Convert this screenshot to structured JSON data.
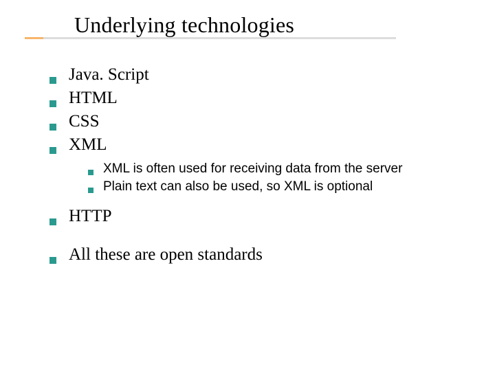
{
  "title": "Underlying technologies",
  "bullets": {
    "items": [
      {
        "label": "Java. Script"
      },
      {
        "label": "HTML"
      },
      {
        "label": "CSS"
      },
      {
        "label": "XML"
      }
    ],
    "sub": [
      {
        "label": "XML is often used for receiving data from the server"
      },
      {
        "label": "Plain text can also be used, so XML is optional"
      }
    ],
    "after": [
      {
        "label": "HTTP"
      },
      {
        "label": "All these are open standards"
      }
    ]
  }
}
